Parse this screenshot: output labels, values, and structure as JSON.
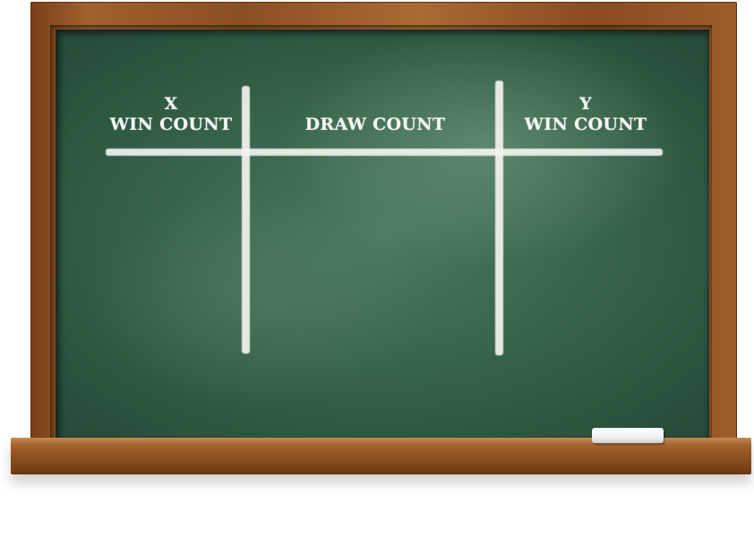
{
  "board": {
    "columns": [
      {
        "line1": "X",
        "line2": "WIN COUNT"
      },
      {
        "line1": "",
        "line2": "DRAW COUNT"
      },
      {
        "line1": "Y",
        "line2": "WIN COUNT"
      }
    ]
  },
  "colors": {
    "board_green": "#3a6650",
    "frame_wood": "#9a5a28",
    "chalk": "#f4f4ef"
  }
}
